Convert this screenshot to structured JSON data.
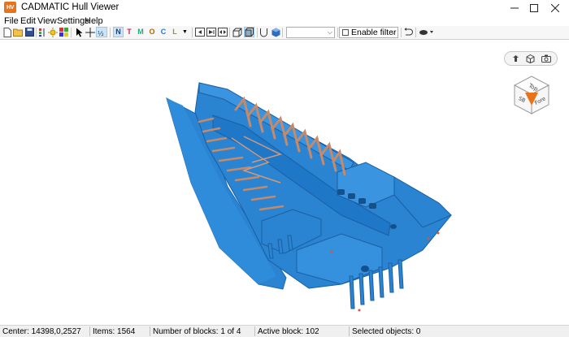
{
  "window": {
    "title": "CADMATIC Hull Viewer",
    "app_icon_text": "HV",
    "controls": [
      "minimize-icon",
      "maximize-icon",
      "close-icon"
    ]
  },
  "menu": {
    "items": [
      "File",
      "Edit",
      "View",
      "Settings",
      "Help"
    ]
  },
  "toolbar": {
    "letter_tools": [
      "N",
      "T",
      "M",
      "O",
      "C",
      "L"
    ],
    "model_combo_value": "",
    "filter_label": "Enable filter",
    "filter_checked": false
  },
  "viewcube": {
    "top": "Top",
    "right_face": "Fore",
    "left_face": "SB"
  },
  "view_toolbox": {
    "icons": [
      "pan-rotate-icon",
      "view-cube-icon",
      "camera-icon"
    ]
  },
  "status": {
    "center": "Center: 14398,0,2527",
    "items": "Items: 1564",
    "blocks": "Number of blocks: 1 of 4",
    "active_block": "Active block: 102",
    "selected": "Selected objects: 0"
  },
  "colors": {
    "hull_blue": "#2a84d2",
    "hull_dark": "#1a5fa3",
    "frame_copper": "#c48a6a",
    "accent_orange": "#e8741a"
  }
}
